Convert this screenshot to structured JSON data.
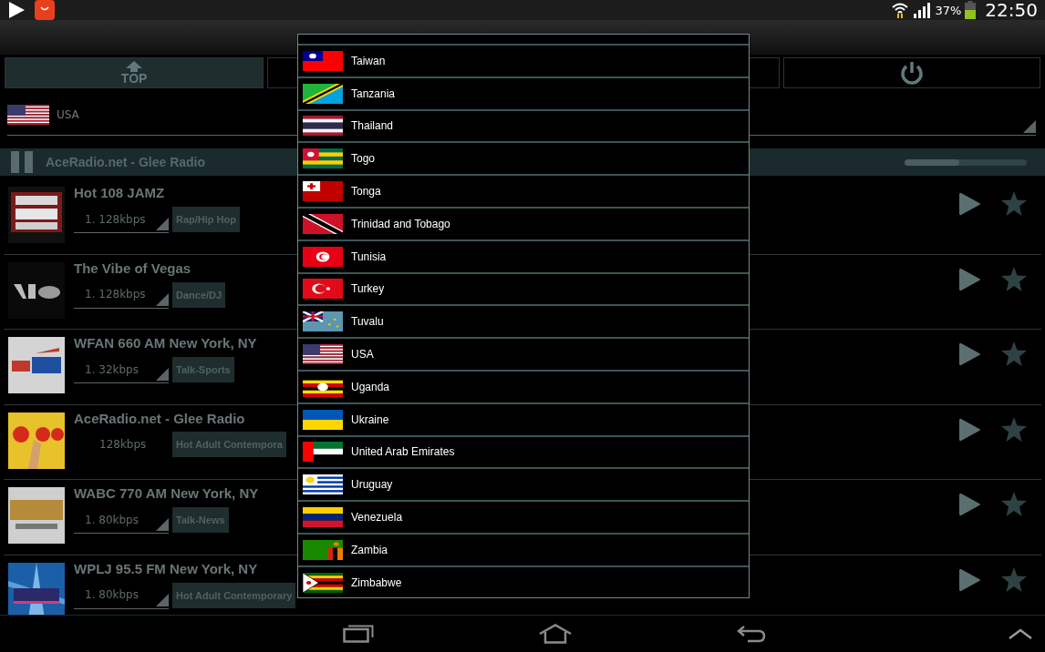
{
  "status_bar": {
    "battery": "37%",
    "time": "22:50"
  },
  "toolbar": {
    "top_button": "TOP"
  },
  "country_spinner": {
    "value": "USA"
  },
  "now_playing": {
    "title": "AceRadio.net - Glee Radio",
    "playing": true,
    "level": 0.45
  },
  "stations": [
    {
      "name": "Hot 108 JAMZ",
      "bitrate": "1. 128kbps",
      "dropdown": true,
      "genre": "Rap/Hip Hop"
    },
    {
      "name": "The Vibe of Vegas",
      "bitrate": "1. 128kbps",
      "dropdown": true,
      "genre": "Dance/DJ"
    },
    {
      "name": "WFAN 660 AM New York, NY",
      "bitrate": "1. 32kbps",
      "dropdown": true,
      "genre": "Talk-Sports"
    },
    {
      "name": "AceRadio.net - Glee Radio",
      "bitrate": "128kbps",
      "dropdown": false,
      "genre": "Hot Adult Contempora"
    },
    {
      "name": "WABC 770 AM New York, NY",
      "bitrate": "1. 80kbps",
      "dropdown": true,
      "genre": "Talk-News"
    },
    {
      "name": "WPLJ 95.5 FM New York, NY",
      "bitrate": "1. 80kbps",
      "dropdown": true,
      "genre": "Hot Adult Contemporary"
    }
  ],
  "country_dialog": {
    "items": [
      {
        "label": "Taiwan"
      },
      {
        "label": "Tanzania"
      },
      {
        "label": "Thailand"
      },
      {
        "label": "Togo"
      },
      {
        "label": "Tonga"
      },
      {
        "label": "Trinidad and Tobago"
      },
      {
        "label": "Tunisia"
      },
      {
        "label": "Turkey"
      },
      {
        "label": "Tuvalu"
      },
      {
        "label": "USA"
      },
      {
        "label": "Uganda"
      },
      {
        "label": "Ukraine"
      },
      {
        "label": "United Arab Emirates"
      },
      {
        "label": "Uruguay"
      },
      {
        "label": "Venezuela"
      },
      {
        "label": "Zambia"
      },
      {
        "label": "Zimbabwe"
      }
    ]
  }
}
